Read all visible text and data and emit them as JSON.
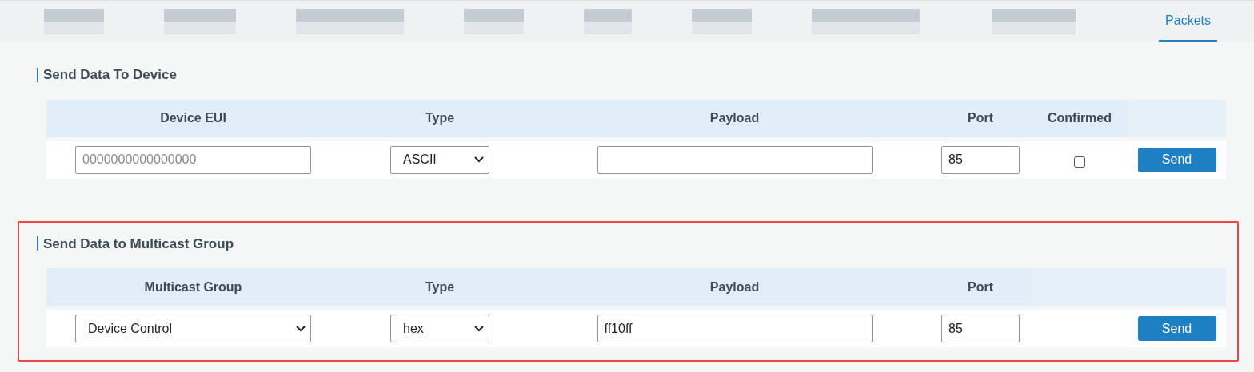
{
  "tabs": [
    {
      "kind": "blurred",
      "selected": false
    },
    {
      "kind": "blurred",
      "selected": false
    },
    {
      "kind": "blurred",
      "selected": false
    },
    {
      "kind": "blurred",
      "selected": false
    },
    {
      "kind": "blurred",
      "selected": false
    },
    {
      "kind": "blurred",
      "selected": false
    },
    {
      "kind": "blurred",
      "selected": false
    },
    {
      "kind": "blurred",
      "selected": false
    },
    {
      "kind": "text",
      "label": "Packets",
      "selected": true
    }
  ],
  "sections": [
    {
      "title": "Send Data To Device",
      "highlighted": false,
      "columns": [
        {
          "label": "Device EUI"
        },
        {
          "label": "Type"
        },
        {
          "label": "Payload"
        },
        {
          "label": "Port"
        },
        {
          "label": "Confirmed"
        },
        {
          "kind": "blank"
        }
      ],
      "cells": [
        {
          "kind": "input",
          "placeholder": "0000000000000000"
        },
        {
          "kind": "select",
          "value": "ASCII"
        },
        {
          "kind": "input"
        },
        {
          "kind": "input",
          "value": "85"
        },
        {
          "kind": "checkbox",
          "checked": false
        },
        {
          "kind": "button",
          "label": "Send"
        }
      ]
    },
    {
      "title": "Send Data to Multicast Group",
      "highlighted": true,
      "columns": [
        {
          "label": "Multicast Group"
        },
        {
          "label": "Type"
        },
        {
          "label": "Payload"
        },
        {
          "label": "Port"
        },
        {
          "kind": "blank"
        },
        {
          "kind": "blank"
        }
      ],
      "cells": [
        {
          "kind": "select",
          "value": "Device Control"
        },
        {
          "kind": "select",
          "value": "hex"
        },
        {
          "kind": "input",
          "value": "ff10ff"
        },
        {
          "kind": "input",
          "value": "85"
        },
        {
          "kind": "blank"
        },
        {
          "kind": "button",
          "label": "Send"
        }
      ]
    }
  ]
}
